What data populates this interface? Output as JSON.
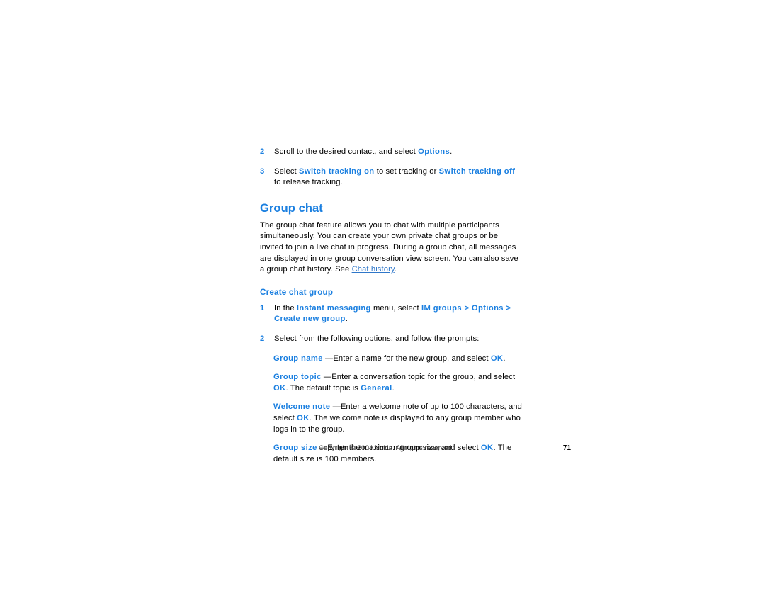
{
  "document": {
    "page_number": "71",
    "footer_copyright": "Copyright © 2004 Nokia. All rights reserved."
  },
  "steps_top": [
    {
      "num": "2",
      "parts": [
        {
          "type": "text",
          "value": "Scroll to the desired contact, and select "
        },
        {
          "type": "keyword",
          "value": "Options"
        },
        {
          "type": "text",
          "value": "."
        }
      ]
    },
    {
      "num": "3",
      "parts": [
        {
          "type": "text",
          "value": "Select "
        },
        {
          "type": "keyword",
          "value": "Switch tracking on"
        },
        {
          "type": "text",
          "value": " to set tracking or "
        },
        {
          "type": "keyword",
          "value": "Switch tracking off"
        },
        {
          "type": "text",
          "value": " to release tracking."
        }
      ]
    }
  ],
  "section": {
    "title": "Group chat",
    "intro_before_link": "The group chat feature allows you to chat with multiple participants simultaneously. You can create your own private chat groups or be invited to join a live chat in progress. During a group chat, all messages are displayed in one group conversation view screen. You can also save a group chat history. See ",
    "intro_link": "Chat history",
    "intro_after_link": ".",
    "subtitle": "Create chat group",
    "steps": [
      {
        "num": "1",
        "parts": [
          {
            "type": "text",
            "value": "In the "
          },
          {
            "type": "keyword",
            "value": "Instant messaging"
          },
          {
            "type": "text",
            "value": " menu, select "
          },
          {
            "type": "keyword",
            "value": "IM groups > Options > Create new group"
          },
          {
            "type": "text",
            "value": "."
          }
        ]
      },
      {
        "num": "2",
        "parts": [
          {
            "type": "text",
            "value": "Select from the following options, and follow the prompts:"
          }
        ]
      }
    ],
    "definitions": [
      {
        "term": "Group name",
        "parts": [
          {
            "type": "text",
            "value": " —Enter a name for the new group, and select "
          },
          {
            "type": "keyword",
            "value": "OK"
          },
          {
            "type": "text",
            "value": "."
          }
        ]
      },
      {
        "term": "Group topic",
        "parts": [
          {
            "type": "text",
            "value": " —Enter a conversation topic for the group, and select "
          },
          {
            "type": "keyword",
            "value": "OK"
          },
          {
            "type": "text",
            "value": ". The default topic is "
          },
          {
            "type": "keyword",
            "value": "General"
          },
          {
            "type": "text",
            "value": "."
          }
        ]
      },
      {
        "term": "Welcome note",
        "parts": [
          {
            "type": "text",
            "value": " —Enter a welcome note of up to 100 characters, and select "
          },
          {
            "type": "keyword",
            "value": "OK"
          },
          {
            "type": "text",
            "value": ". The welcome note is displayed to any group member who logs in to the group."
          }
        ]
      },
      {
        "term": "Group size",
        "parts": [
          {
            "type": "text",
            "value": " —Enter the maximum group size, and select "
          },
          {
            "type": "keyword",
            "value": "OK"
          },
          {
            "type": "text",
            "value": ". The default size is 100 members."
          }
        ]
      }
    ]
  },
  "colors": {
    "heading_blue": "#1a7fe0",
    "keyword_blue": "#1a7fe0",
    "link_blue": "#2f77c9",
    "body_black": "#000000",
    "page_background": "#ffffff"
  }
}
